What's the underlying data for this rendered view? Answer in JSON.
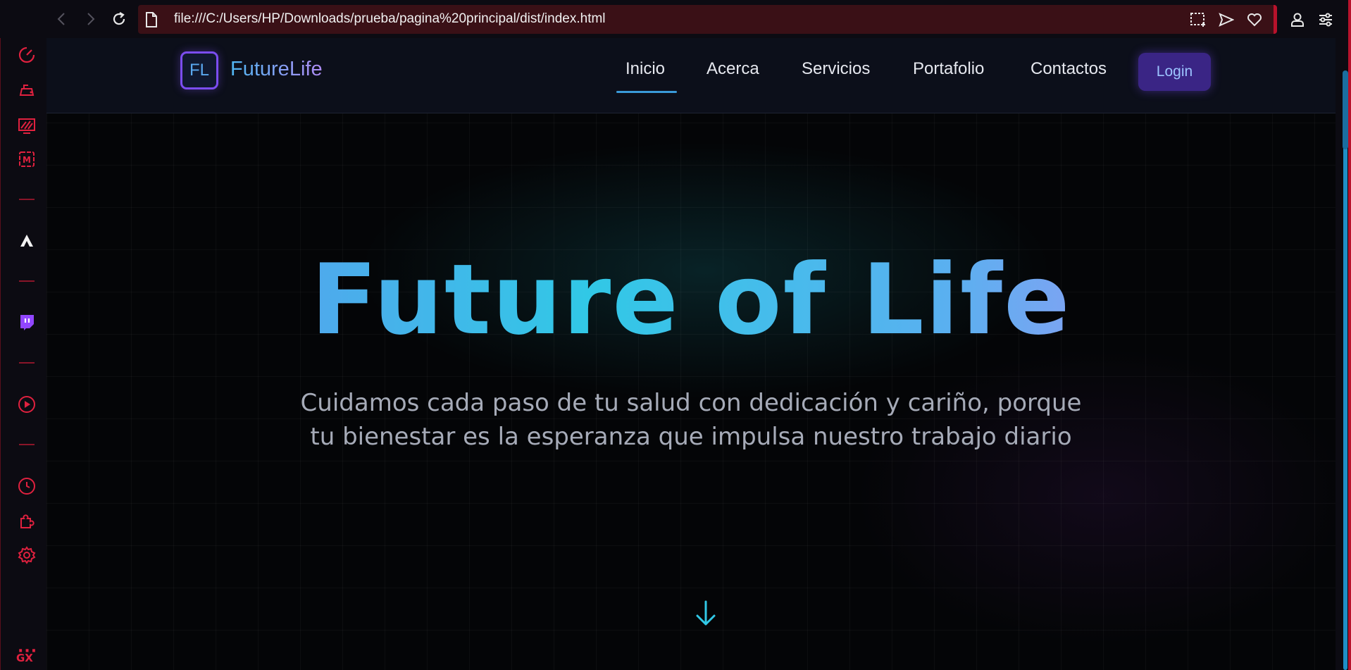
{
  "browser": {
    "url": "file:///C:/Users/HP/Downloads/prueba/pagina%20principal/dist/index.html",
    "accent_color": "#e0213f",
    "toolbar_icons": [
      "back-icon",
      "forward-icon",
      "reload-icon",
      "file-icon",
      "snapshot-icon",
      "send-icon",
      "heart-icon",
      "account-icon",
      "easy-setup-icon"
    ]
  },
  "sidebar": {
    "items": [
      {
        "name": "speed-dial-icon"
      },
      {
        "name": "gx-control-icon"
      },
      {
        "name": "gx-corner-icon"
      },
      {
        "name": "messenger-m-icon"
      },
      {
        "name": "app-a-icon"
      },
      {
        "name": "twitch-icon"
      },
      {
        "name": "player-icon"
      },
      {
        "name": "history-icon"
      },
      {
        "name": "extensions-icon"
      },
      {
        "name": "settings-icon"
      }
    ],
    "gx_label": "GX",
    "more_label": "···"
  },
  "site": {
    "logo_initials": "FL",
    "brand": "FutureLife",
    "nav": {
      "inicio": "Inicio",
      "acerca": "Acerca",
      "servicios": "Servicios",
      "portafolio": "Portafolio",
      "contactos": "Contactos",
      "login": "Login"
    },
    "active_nav": "Inicio",
    "hero_title": "Future of Life",
    "hero_subtitle_line1": "Cuidamos cada paso de tu salud con dedicación y cariño, porque",
    "hero_subtitle_line2": "tu bienestar es la esperanza que impulsa nuestro trabajo diario",
    "colors": {
      "brand_purple": "#7b4df0",
      "accent_cyan": "#31c8e6",
      "login_bg": "#3a2585"
    }
  }
}
